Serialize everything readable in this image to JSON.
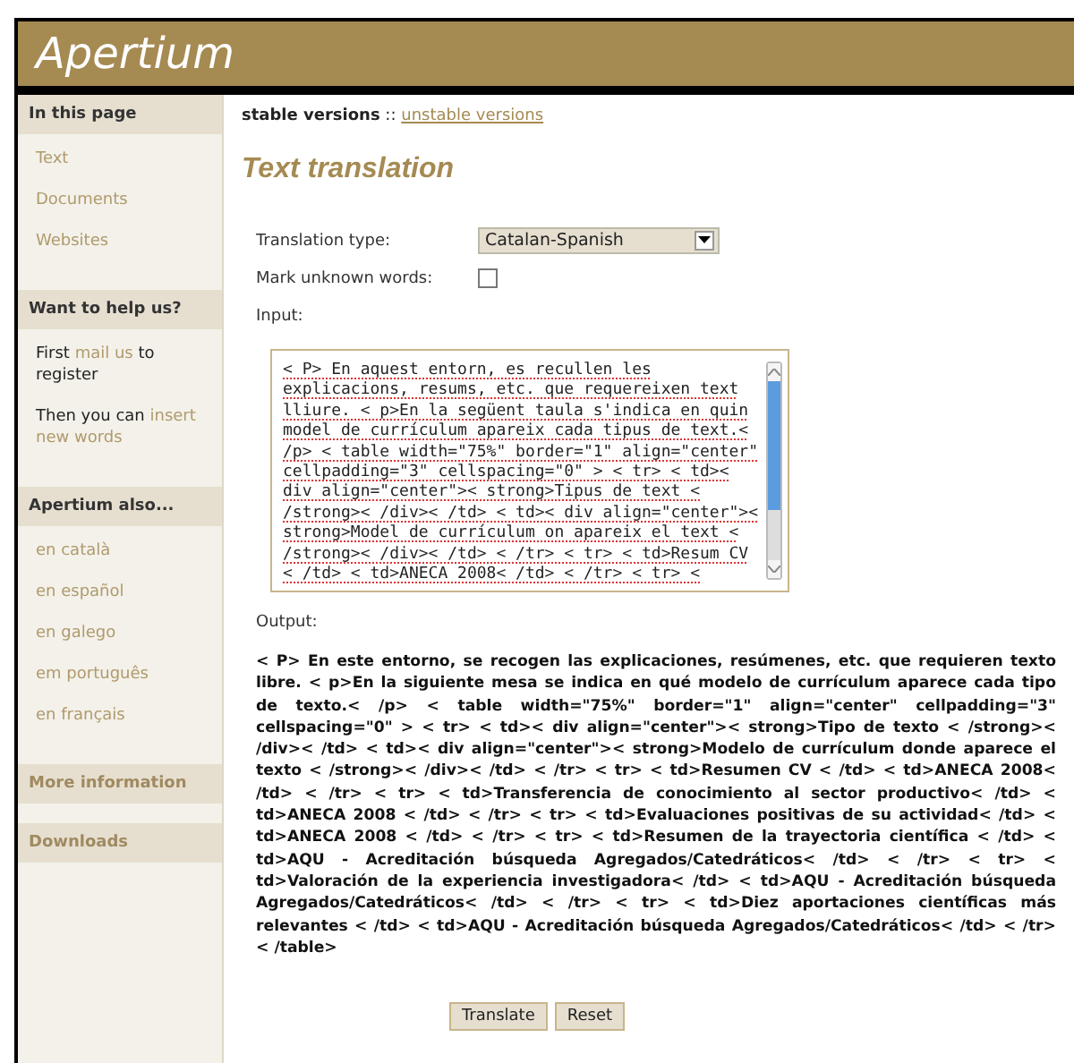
{
  "header": {
    "logo": "Apertium"
  },
  "sidebar": [
    {
      "heading": "In this page",
      "link_heading": false,
      "items": [
        [
          {
            "text": "Text",
            "link": true
          }
        ],
        [
          {
            "text": "Documents",
            "link": true
          }
        ],
        [
          {
            "text": "Websites",
            "link": true
          }
        ]
      ]
    },
    {
      "heading": "Want to help us?",
      "link_heading": false,
      "items": [
        [
          {
            "text": "First ",
            "link": false
          },
          {
            "text": "mail us",
            "link": true
          },
          {
            "text": " to register",
            "link": false
          }
        ],
        [
          {
            "text": "Then you can ",
            "link": false
          },
          {
            "text": "insert",
            "link": true
          },
          {
            "text": "new words",
            "link": true
          }
        ]
      ]
    },
    {
      "heading": "Apertium also...",
      "link_heading": false,
      "items": [
        [
          {
            "text": "en català",
            "link": true
          }
        ],
        [
          {
            "text": "en español",
            "link": true
          }
        ],
        [
          {
            "text": "en galego",
            "link": true
          }
        ],
        [
          {
            "text": "em português",
            "link": true
          }
        ],
        [
          {
            "text": "en français",
            "link": true
          }
        ]
      ]
    },
    {
      "heading": "More information",
      "link_heading": true
    },
    {
      "heading": "Downloads",
      "link_heading": true
    }
  ],
  "versions": {
    "current": "stable versions",
    "separator": "::",
    "other": "unstable versions"
  },
  "title": "Text translation",
  "form": {
    "translation_type_label": "Translation type:",
    "translation_type": "Catalan-Spanish",
    "mark_unknown_label": "Mark unknown words:",
    "mark_unknown_checked": false,
    "input_label": "Input:",
    "input_value": "< P> En aquest entorn, es recullen les\nexplicacions, resums, etc. que requereixen text\nlliure. < p>En la següent taula s'indica en quin\nmodel de currículum apareix cada tipus de text.<\n/p> < table width=\"75%\" border=\"1\" align=\"center\"\ncellpadding=\"3\" cellspacing=\"0\" > < tr> < td><\ndiv align=\"center\">< strong>Tipus de text <\n/strong>< /div>< /td> < td>< div align=\"center\"><\nstrong>Model de currículum on apareix el text <\n/strong>< /div>< /td> < /tr> < tr> < td>Resum CV\n< /td> < td>ANECA 2008< /td> < /tr> < tr> <",
    "output_label": "Output:",
    "output_text": "< P> En este entorno, se recogen las explicaciones, resúmenes, etc. que requieren texto libre. < p>En la siguiente mesa se indica en qué modelo de currículum aparece cada tipo de texto.< /p> < table width=\"75%\" border=\"1\" align=\"center\" cellpadding=\"3\" cellspacing=\"0\" > < tr> < td>< div align=\"center\">< strong>Tipo de texto < /strong>< /div>< /td> < td>< div align=\"center\">< strong>Modelo de currículum donde aparece el texto < /strong>< /div>< /td> < /tr> < tr> < td>Resumen CV < /td> < td>ANECA 2008< /td> < /tr> < tr> < td>Transferencia de conocimiento al sector productivo< /td> < td>ANECA 2008 < /td> < /tr> < tr> < td>Evaluaciones positivas de su actividad< /td> < td>ANECA 2008 < /td> < /tr> < tr> < td>Resumen de la trayectoria científica < /td> < td>AQU - Acreditación búsqueda Agregados/Catedráticos< /td> < /tr> < tr> < td>Valoración de la experiencia investigadora< /td> < td>AQU - Acreditación búsqueda Agregados/Catedráticos< /td> < /tr> < tr> < td>Diez aportaciones científicas más relevantes < /td> < td>AQU - Acreditación búsqueda Agregados/Catedráticos< /td> < /tr> < /table>",
    "buttons": [
      "Translate",
      "Reset"
    ]
  }
}
